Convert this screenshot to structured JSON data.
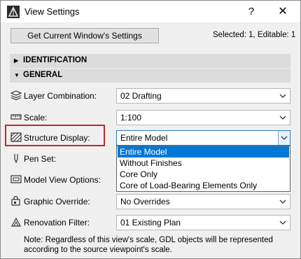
{
  "window": {
    "title": "View Settings",
    "help_label": "?",
    "close_label": "✕"
  },
  "toolbar": {
    "get_button_label": "Get Current Window's Settings",
    "selected_info": "Selected: 1, Editable: 1"
  },
  "sections": [
    {
      "label": "IDENTIFICATION",
      "expanded": false
    },
    {
      "label": "GENERAL",
      "expanded": true
    }
  ],
  "fields": {
    "layer_combination": {
      "label": "Layer Combination:",
      "value": "02 Drafting",
      "icon": "layers-icon"
    },
    "scale": {
      "label": "Scale:",
      "value": "1:100",
      "icon": "ruler-icon"
    },
    "structure_display": {
      "label": "Structure Display:",
      "value": "Entire Model",
      "icon": "structure-hatch-icon"
    },
    "pen_set": {
      "label": "Pen Set:",
      "icon": "pen-icon"
    },
    "model_view_options": {
      "label": "Model View Options:",
      "icon": "model-view-icon"
    },
    "graphic_override": {
      "label": "Graphic Override:",
      "value": "No Overrides",
      "icon": "graphic-override-icon"
    },
    "renovation_filter": {
      "label": "Renovation Filter:",
      "value": "01 Existing Plan",
      "icon": "renovation-icon"
    }
  },
  "structure_dropdown": {
    "options": [
      "Entire Model",
      "Without Finishes",
      "Core Only",
      "Core of Load-Bearing Elements Only"
    ],
    "selected_index": 0
  },
  "note": "Note: Regardless of this view's scale, GDL objects will be represented according to the source viewpoint's scale.",
  "colors": {
    "highlight_border": "#c0272d",
    "selection_blue": "#0078d7",
    "section_bg": "#dcdcdc",
    "window_bg": "#f0f0f0"
  }
}
